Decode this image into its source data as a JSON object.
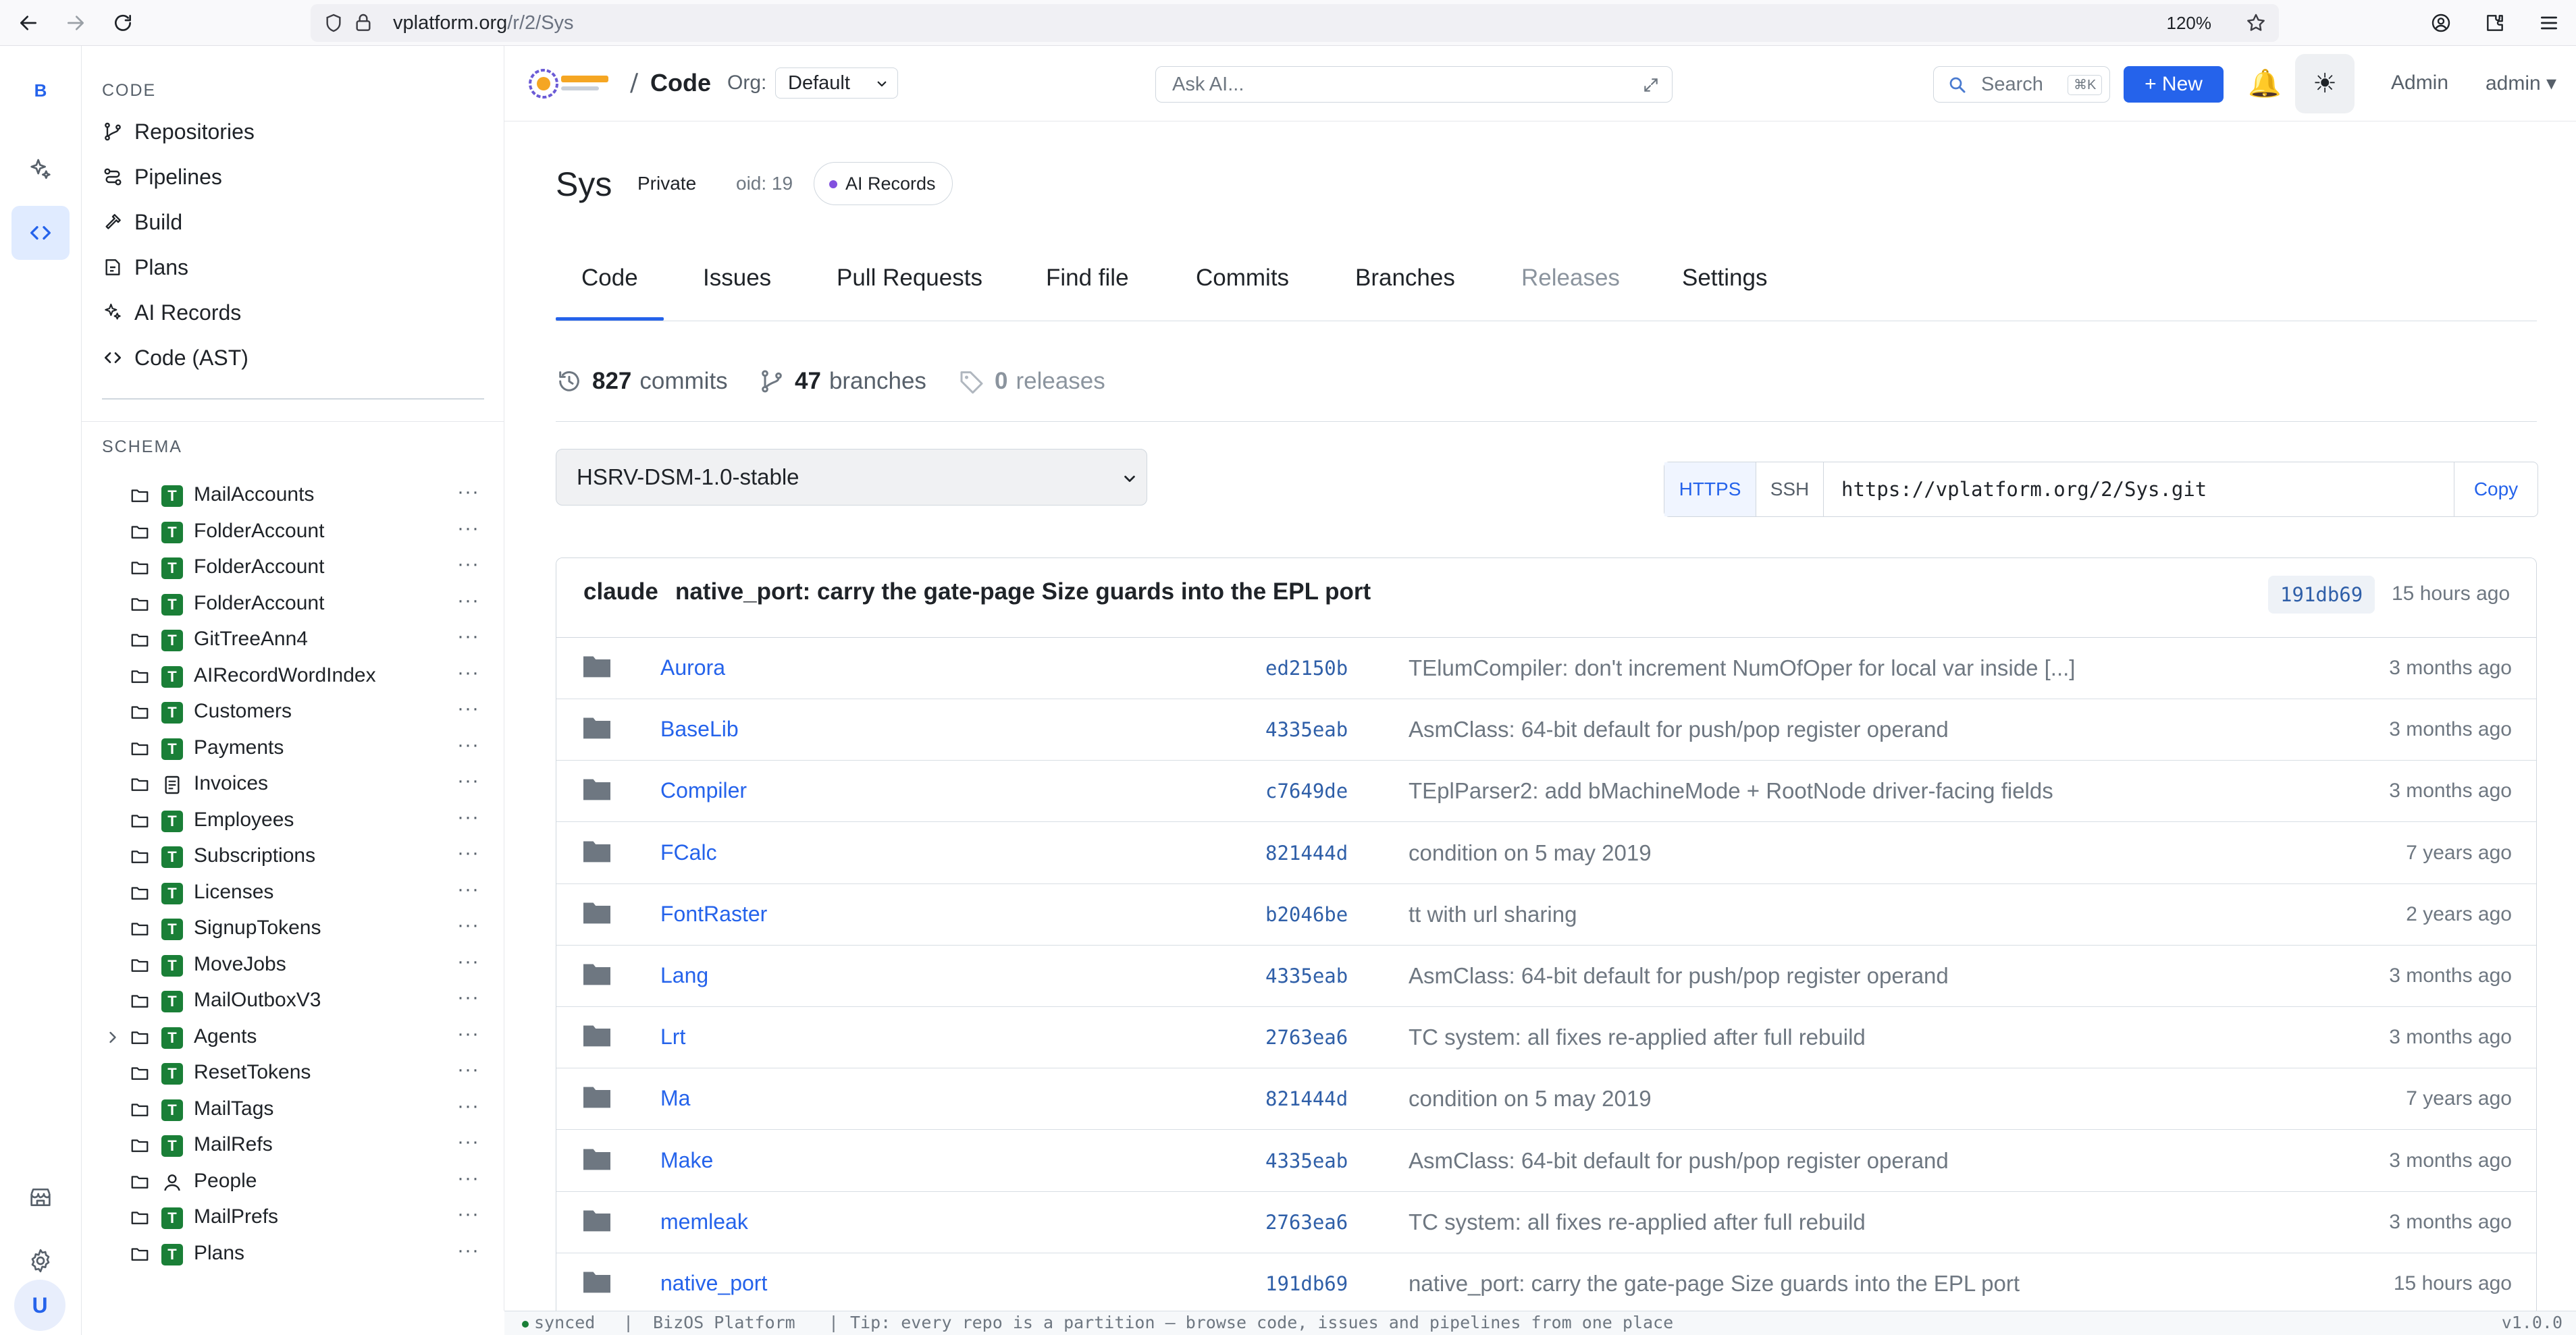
{
  "browser": {
    "url_host": "vplatform.org",
    "url_path": "/r/2/Sys",
    "zoom": "120%"
  },
  "rail": {
    "brand": "B",
    "avatar": "U"
  },
  "sidebar": {
    "code_label": "CODE",
    "code_items": [
      {
        "label": "Repositories",
        "icon": "git-branch-icon"
      },
      {
        "label": "Pipelines",
        "icon": "pipeline-icon"
      },
      {
        "label": "Build",
        "icon": "hammer-icon"
      },
      {
        "label": "Plans",
        "icon": "plan-icon"
      },
      {
        "label": "AI Records",
        "icon": "sparkles-icon"
      },
      {
        "label": "Code (AST)",
        "icon": "code-icon"
      }
    ],
    "schema_label": "SCHEMA",
    "schema_items": [
      {
        "name": "MailAccounts",
        "badge": "T"
      },
      {
        "name": "FolderAccount",
        "badge": "T"
      },
      {
        "name": "FolderAccount",
        "badge": "T"
      },
      {
        "name": "FolderAccount",
        "badge": "T"
      },
      {
        "name": "GitTreeAnn4",
        "badge": "T"
      },
      {
        "name": "AIRecordWordIndex",
        "badge": "T"
      },
      {
        "name": "Customers",
        "badge": "T"
      },
      {
        "name": "Payments",
        "badge": "T"
      },
      {
        "name": "Invoices",
        "badge": "doc"
      },
      {
        "name": "Employees",
        "badge": "T"
      },
      {
        "name": "Subscriptions",
        "badge": "T"
      },
      {
        "name": "Licenses",
        "badge": "T"
      },
      {
        "name": "SignupTokens",
        "badge": "T"
      },
      {
        "name": "MoveJobs",
        "badge": "T"
      },
      {
        "name": "MailOutboxV3",
        "badge": "T"
      },
      {
        "name": "Agents",
        "badge": "T",
        "expandable": true
      },
      {
        "name": "ResetTokens",
        "badge": "T"
      },
      {
        "name": "MailTags",
        "badge": "T"
      },
      {
        "name": "MailRefs",
        "badge": "T"
      },
      {
        "name": "People",
        "badge": "person"
      },
      {
        "name": "MailPrefs",
        "badge": "T"
      },
      {
        "name": "Plans",
        "badge": "T"
      }
    ],
    "row_menu": "···"
  },
  "header": {
    "slash": "/",
    "section": "Code",
    "org_label": "Org:",
    "org_value": "Default",
    "ask_placeholder": "Ask AI...",
    "search_label": "Search",
    "search_kbd": "⌘K",
    "new_label": "+ New",
    "admin_link": "Admin",
    "user_menu": "admin ▾"
  },
  "repo": {
    "name": "Sys",
    "visibility": "Private",
    "oid": "oid: 19",
    "ai_badge": "AI Records"
  },
  "tabs": [
    {
      "label": "Code",
      "active": true
    },
    {
      "label": "Issues"
    },
    {
      "label": "Pull Requests"
    },
    {
      "label": "Find file"
    },
    {
      "label": "Commits"
    },
    {
      "label": "Branches"
    },
    {
      "label": "Releases",
      "muted": true
    },
    {
      "label": "Settings"
    }
  ],
  "stats": {
    "commits_count": "827",
    "commits_label": "commits",
    "branches_count": "47",
    "branches_label": "branches",
    "releases_count": "0",
    "releases_label": "releases"
  },
  "branch": {
    "selected": "HSRV-DSM-1.0-stable"
  },
  "clone": {
    "https_label": "HTTPS",
    "ssh_label": "SSH",
    "url": "https://vplatform.org/2/Sys.git",
    "copy_label": "Copy"
  },
  "last_commit": {
    "author": "claude",
    "message": "native_port: carry the gate-page Size guards into the EPL port",
    "sha": "191db69",
    "when": "15 hours ago"
  },
  "files": [
    {
      "name": "Aurora",
      "sha": "ed2150b",
      "message": "TElumCompiler: don't increment NumOfOper for local var inside [...]",
      "when": "3 months ago"
    },
    {
      "name": "BaseLib",
      "sha": "4335eab",
      "message": "AsmClass: 64-bit default for push/pop register operand",
      "when": "3 months ago"
    },
    {
      "name": "Compiler",
      "sha": "c7649de",
      "message": "TEplParser2: add bMachineMode + RootNode driver-facing fields",
      "when": "3 months ago"
    },
    {
      "name": "FCalc",
      "sha": "821444d",
      "message": "condition on 5 may 2019",
      "when": "7 years ago"
    },
    {
      "name": "FontRaster",
      "sha": "b2046be",
      "message": "tt with url sharing",
      "when": "2 years ago"
    },
    {
      "name": "Lang",
      "sha": "4335eab",
      "message": "AsmClass: 64-bit default for push/pop register operand",
      "when": "3 months ago"
    },
    {
      "name": "Lrt",
      "sha": "2763ea6",
      "message": "TC system: all fixes re-applied after full rebuild",
      "when": "3 months ago"
    },
    {
      "name": "Ma",
      "sha": "821444d",
      "message": "condition on 5 may 2019",
      "when": "7 years ago"
    },
    {
      "name": "Make",
      "sha": "4335eab",
      "message": "AsmClass: 64-bit default for push/pop register operand",
      "when": "3 months ago"
    },
    {
      "name": "memleak",
      "sha": "2763ea6",
      "message": "TC system: all fixes re-applied after full rebuild",
      "when": "3 months ago"
    },
    {
      "name": "native_port",
      "sha": "191db69",
      "message": "native_port: carry the gate-page Size guards into the EPL port",
      "when": "15 hours ago"
    }
  ],
  "status": {
    "sync": "synced",
    "sep": "|",
    "product": "BizOS Platform",
    "tip": "Tip: every repo is a partition — browse code, issues and pipelines from one place",
    "version": "v1.0.0"
  },
  "colors": {
    "accent": "#2563eb",
    "table_badge": "#1a7f37"
  }
}
